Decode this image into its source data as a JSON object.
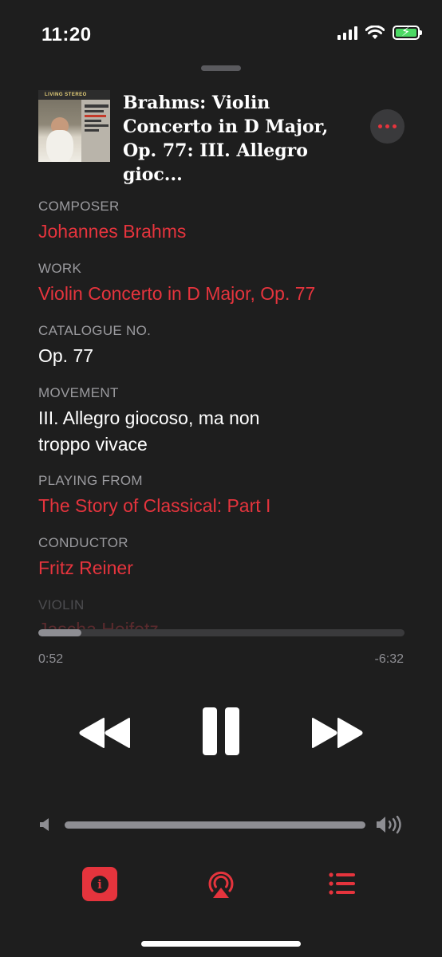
{
  "status_bar": {
    "time": "11:20"
  },
  "now_playing": {
    "title": "Brahms: Violin Concerto in D Major, Op. 77: III. Allegro gioc...",
    "artwork": {
      "banner": "LIVING STEREO"
    }
  },
  "info": {
    "composer": {
      "label": "COMPOSER",
      "value": "Johannes Brahms"
    },
    "work": {
      "label": "WORK",
      "value": "Violin Concerto in D Major, Op. 77"
    },
    "catalogue": {
      "label": "CATALOGUE NO.",
      "value": "Op. 77"
    },
    "movement": {
      "label": "MOVEMENT",
      "value_line1": "III. Allegro giocoso, ma non",
      "value_line2": "troppo vivace"
    },
    "playing_from": {
      "label": "PLAYING FROM",
      "value": "The Story of Classical: Part I"
    },
    "conductor": {
      "label": "CONDUCTOR",
      "value": "Fritz Reiner"
    },
    "violin": {
      "label": "VIOLIN",
      "value": "Jascha Heifetz"
    }
  },
  "playback": {
    "elapsed": "0:52",
    "remaining": "-6:32",
    "progress_fraction": 0.117
  },
  "volume": {
    "level_fraction": 1.0
  },
  "colors": {
    "accent": "#e5343d",
    "background": "#1e1e1e"
  },
  "icons": {
    "more": "ellipsis-icon",
    "rewind": "rewind-icon",
    "pause": "pause-icon",
    "forward": "fast-forward-icon",
    "volume_low": "speaker-low-icon",
    "volume_high": "speaker-high-icon",
    "info": "info-icon",
    "airplay": "airplay-icon",
    "queue": "queue-list-icon"
  }
}
